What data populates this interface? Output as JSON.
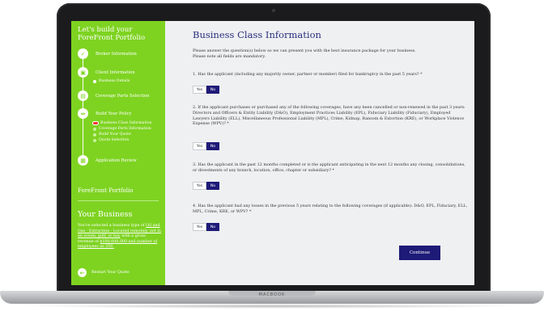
{
  "laptop": {
    "brand": "MACBOOK"
  },
  "sidebar": {
    "title": "Let's build your ForeFront Portfolio",
    "steps": [
      {
        "label": "Broker Information",
        "icon": "check-icon"
      },
      {
        "label": "Client Information",
        "icon": "briefcase-icon"
      },
      {
        "label": "Coverage Parts Selection",
        "icon": "clipboard-icon"
      },
      {
        "label": "Build Your Policy",
        "icon": "tools-icon"
      },
      {
        "label": "Application Review",
        "icon": "document-icon"
      }
    ],
    "client_sub": "Business Details",
    "policy_subs": [
      "Business Class Information",
      "Coverage Parts Information",
      "Build Your Quote",
      "Quote Selection"
    ],
    "portfolio_label": "ForeFront Portfolio",
    "your_business_title": "Your Business",
    "desc_prefix": "You've selected a business type of",
    "desc_business": "Oil and Gas - Extraction - Located remotely, not in an ocean, gulf, or bay",
    "desc_middle": "with a gross revenue of",
    "desc_revenue": "$100,000,000 and number of employees as 250.",
    "restart_label": "Restart Your Quote"
  },
  "main": {
    "title": "Business Class Information",
    "intro_line1": "Please answer the question(s) below so we can present you with the best insurance package for your business.",
    "intro_line2": "Please note all fields are mandatory.",
    "questions": [
      {
        "text": "1. Has the applicant (including any majority owner, partner or member) filed for bankruptcy in the past 5 years? *",
        "yes": "Yes",
        "no": "No",
        "selected": "No"
      },
      {
        "text": "2. If the applicant purchases or purchased any of the following coverages, have any been cancelled or non-renewed in the past 3 years: Directors and Officers & Entity Liability (D&O), Employment Practices Liability (EPL), Fiduciary Liability (Fiduciary), Employed Lawyers Liability (ELL), Miscellaneous Professional Liability (MPL), Crime, Kidnap, Ransom & Extortion (KRE), or Workplace Violence Expense (WPV)? *",
        "yes": "Yes",
        "no": "No",
        "selected": "No"
      },
      {
        "text": "3. Has the applicant in the past 12 months completed or is the applicant anticipating in the next 12 months any closing, consolidations, or divestments of any branch, location, office, chapter or subsidiary? *",
        "yes": "Yes",
        "no": "No",
        "selected": "No"
      },
      {
        "text": "4. Has the applicant had any losses in the previous 5 years relating to the following coverages (if applicable): D&O, EPL, Fiduciary, ELL, MPL, Crime, KRE, or WPV? *",
        "yes": "Yes",
        "no": "No",
        "selected": "No"
      }
    ],
    "continue_label": "Continue"
  },
  "colors": {
    "sidebar": "#7ed321",
    "accent": "#1e1a78",
    "title": "#2b2f7c"
  }
}
